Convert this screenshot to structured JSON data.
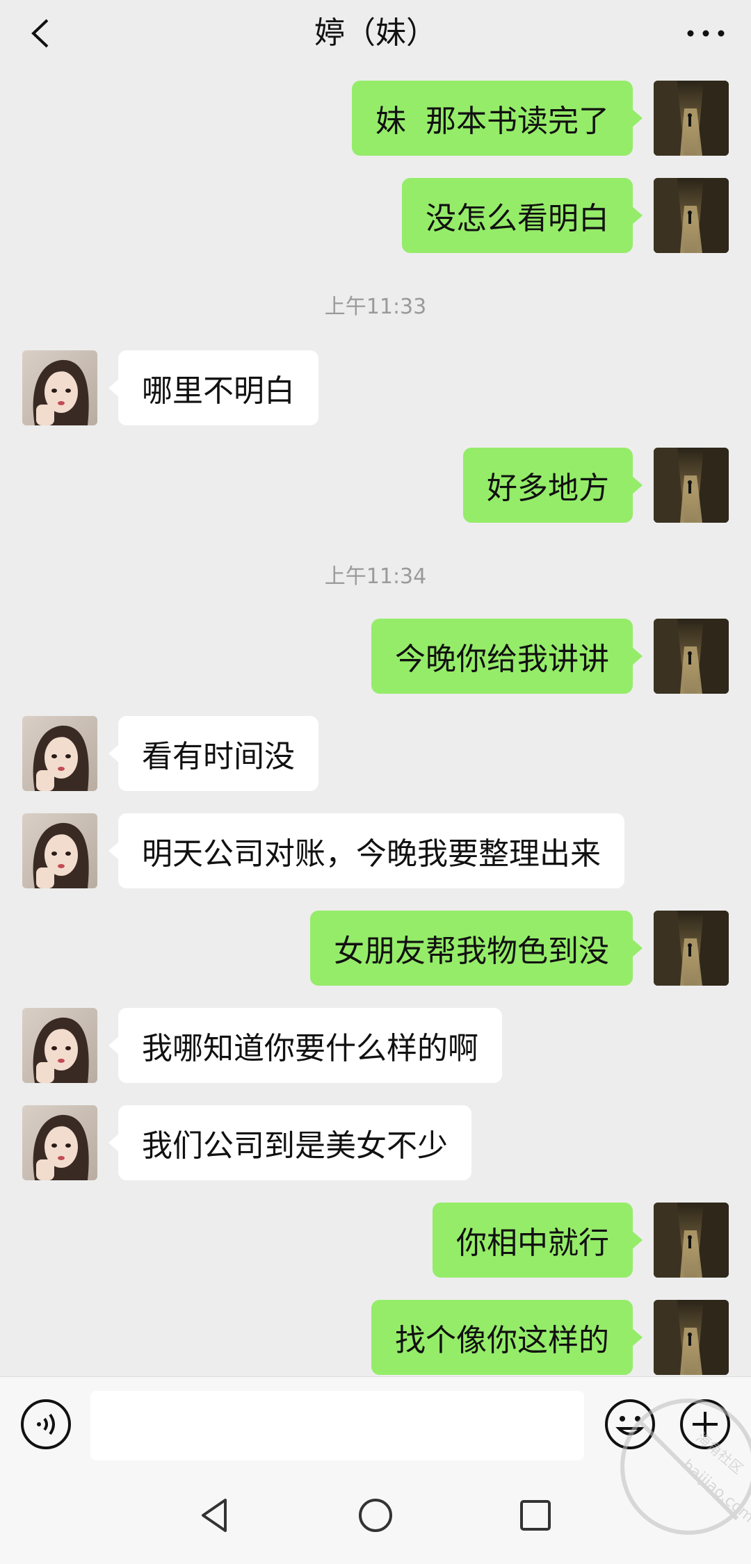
{
  "header": {
    "title": "婷（妹）"
  },
  "messages": {
    "m1": "妹  那本书读完了",
    "m2": "没怎么看明白",
    "t1": "上午11:33",
    "m3": "哪里不明白",
    "m4": "好多地方",
    "t2": "上午11:34",
    "m5": "今晚你给我讲讲",
    "m6": "看有时间没",
    "m7": "明天公司对账，今晚我要整理出来",
    "m8": "女朋友帮我物色到没",
    "m9": "我哪知道你要什么样的啊",
    "m10": "我们公司到是美女不少",
    "m11": "你相中就行",
    "m12": "找个像你这样的"
  },
  "icons": {
    "back": "chevron-left-icon",
    "more": "more-dots-icon",
    "voice": "voice-icon",
    "emoji": "emoji-icon",
    "plus": "plus-icon",
    "nav_back": "triangle-back-icon",
    "nav_home": "circle-home-icon",
    "nav_recent": "square-recent-icon"
  },
  "colors": {
    "background": "#ededed",
    "my_bubble": "#95ec69",
    "their_bubble": "#ffffff",
    "timestamp": "#9a9a9a"
  },
  "watermark": {
    "site": "haijiao.com",
    "name": "海角社区"
  }
}
